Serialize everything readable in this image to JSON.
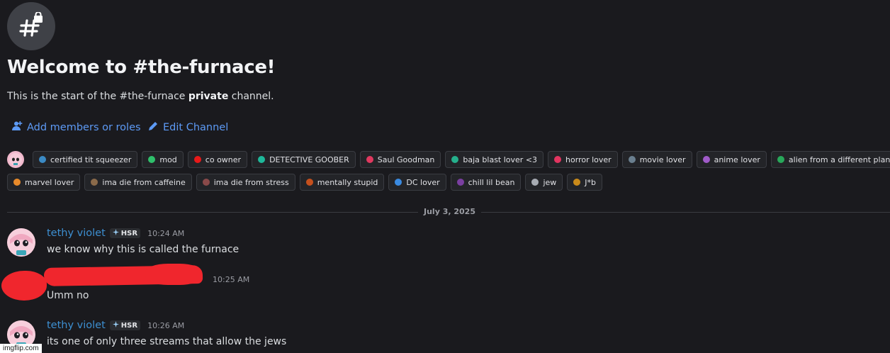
{
  "channel": {
    "icon": "hashtag-lock-icon",
    "welcome_title": "Welcome to #the-furnace!",
    "subtitle_before": "This is the start of the #the-furnace ",
    "subtitle_bold": "private",
    "subtitle_after": " channel."
  },
  "actions": {
    "add_members": "Add members or roles",
    "edit_channel": "Edit Channel"
  },
  "roles_row1": [
    {
      "name": "certified tit squeezer",
      "color": "#3b8ac4"
    },
    {
      "name": "mod",
      "color": "#2fc06b"
    },
    {
      "name": "co owner",
      "color": "#e81919"
    },
    {
      "name": "DETECTIVE GOOBER",
      "color": "#1eb89a"
    },
    {
      "name": "Saul Goodman",
      "color": "#e0395f"
    },
    {
      "name": "baja blast lover <3",
      "color": "#25b08c"
    },
    {
      "name": "horror lover",
      "color": "#e23560"
    },
    {
      "name": "movie lover",
      "color": "#6a7f8f"
    },
    {
      "name": "anime lover",
      "color": "#a05bc9"
    },
    {
      "name": "alien from a different planet",
      "color": "#28a85a"
    }
  ],
  "roles_row2": [
    {
      "name": "marvel lover",
      "color": "#e88a2a"
    },
    {
      "name": "ima die from caffeine",
      "color": "#8a6a4a"
    },
    {
      "name": "ima die from stress",
      "color": "#8a4a4a"
    },
    {
      "name": "mentally stupid",
      "color": "#c5501d"
    },
    {
      "name": "DC lover",
      "color": "#3a8ae0"
    },
    {
      "name": "chill lil bean",
      "color": "#7a3fa0"
    },
    {
      "name": "jew",
      "color": "#a8acb3"
    },
    {
      "name": "J*b",
      "color": "#c98a1a"
    }
  ],
  "date_divider": "July 3, 2025",
  "messages": [
    {
      "username": "tethy violet",
      "tag": "HSR",
      "time": "10:24 AM",
      "text": "we know why this is called the furnace"
    },
    {
      "username": "",
      "tag": "",
      "time": "10:25 AM",
      "text": "Umm no"
    },
    {
      "username": "tethy violet",
      "tag": "HSR",
      "time": "10:26 AM",
      "text": "its one of only three streams that allow the jews"
    }
  ],
  "watermark": "imgflip.com"
}
